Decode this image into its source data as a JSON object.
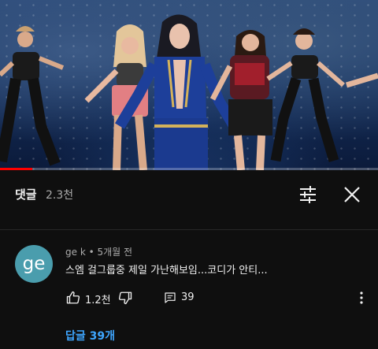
{
  "video": {
    "progress_fraction": 0.085
  },
  "comments_header": {
    "title": "댓글",
    "count": "2.3천"
  },
  "comment": {
    "avatar_text": "ge",
    "author": "ge k",
    "separator": "•",
    "time": "5개월 전",
    "text": "스엠 걸그룹중 제일 가난해보임...코디가 안티...",
    "like_count": "1.2천",
    "reply_count": "39",
    "replies_link": "답글 39개"
  },
  "colors": {
    "background": "#0f0f0f",
    "avatar": "#4a9dad",
    "link": "#3ea6ff",
    "progress": "#ff0000",
    "secondary_text": "#aaaaaa"
  },
  "icons": [
    "sliders-icon",
    "close-icon",
    "thumbs-up-icon",
    "thumbs-down-icon",
    "reply-icon",
    "more-vert-icon"
  ]
}
